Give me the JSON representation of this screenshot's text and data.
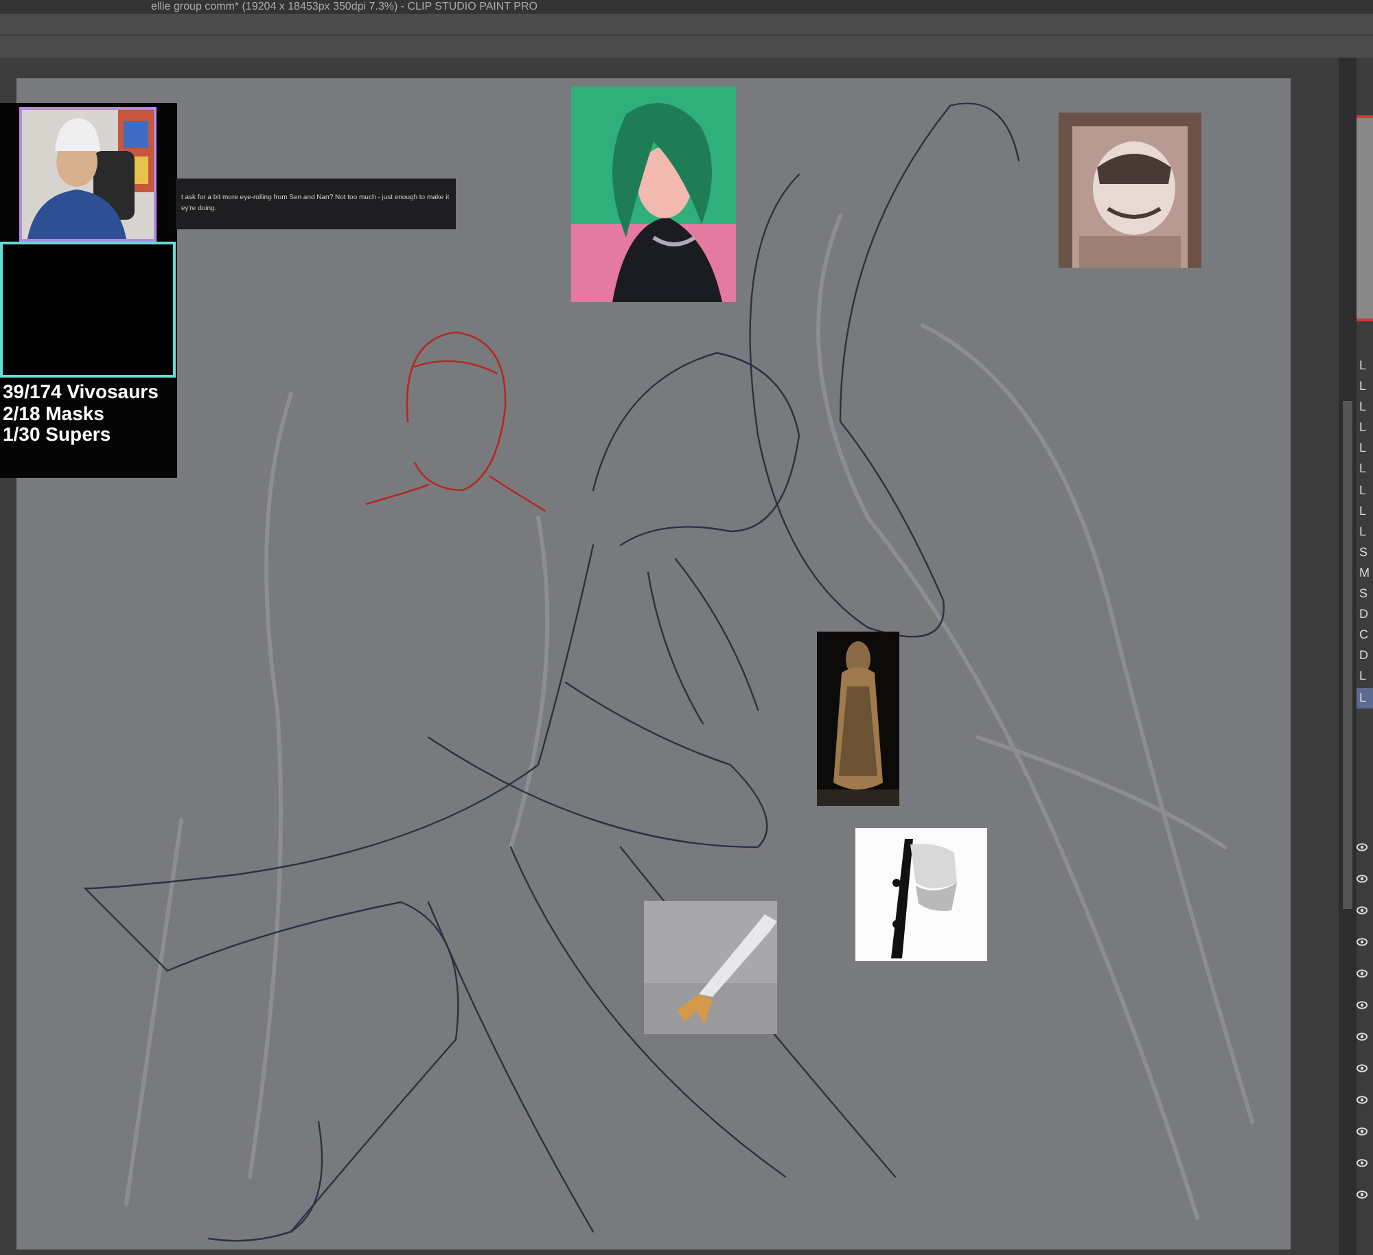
{
  "window": {
    "title": "ellie group comm* (19204 x 18453px 350dpi 7.3%) - CLIP STUDIO PAINT PRO"
  },
  "stream_overlay": {
    "chat_lines": [
      "t ask for a bit more eye-rolling from Sen and Nan? Not too much - just enough to make it",
      "ey're doing."
    ],
    "counters": [
      "39/174 Vivosaurs",
      "2/18 Masks",
      "1/30 Supers"
    ]
  },
  "layer_panel": {
    "layers": [
      {
        "label": "L",
        "selected": false
      },
      {
        "label": "L",
        "selected": false
      },
      {
        "label": "L",
        "selected": false
      },
      {
        "label": "L",
        "selected": false
      },
      {
        "label": "L",
        "selected": false
      },
      {
        "label": "L",
        "selected": false
      },
      {
        "label": "L",
        "selected": false
      },
      {
        "label": "L",
        "selected": false
      },
      {
        "label": "L",
        "selected": false
      },
      {
        "label": "S",
        "selected": false
      },
      {
        "label": "M",
        "selected": false
      },
      {
        "label": "S",
        "selected": false
      },
      {
        "label": "D",
        "selected": false
      },
      {
        "label": "C",
        "selected": false
      },
      {
        "label": "D",
        "selected": false
      },
      {
        "label": "L",
        "selected": false
      },
      {
        "label": "L",
        "selected": true
      }
    ],
    "rows": [
      {
        "visible": true
      },
      {
        "visible": true
      },
      {
        "visible": true
      },
      {
        "visible": true
      },
      {
        "visible": true
      },
      {
        "visible": true
      },
      {
        "visible": true
      },
      {
        "visible": true
      },
      {
        "visible": true
      },
      {
        "visible": true
      },
      {
        "visible": true
      },
      {
        "visible": true
      }
    ]
  }
}
